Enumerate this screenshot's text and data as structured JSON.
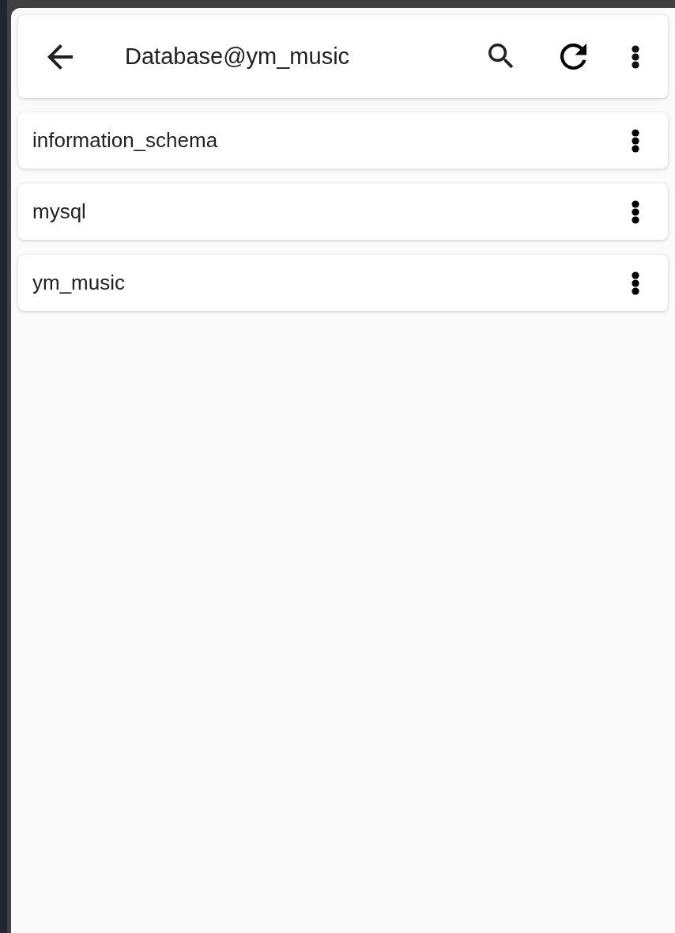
{
  "toolbar": {
    "title": "Database@ym_music"
  },
  "databases": [
    {
      "name": "information_schema"
    },
    {
      "name": "mysql"
    },
    {
      "name": "ym_music"
    }
  ]
}
